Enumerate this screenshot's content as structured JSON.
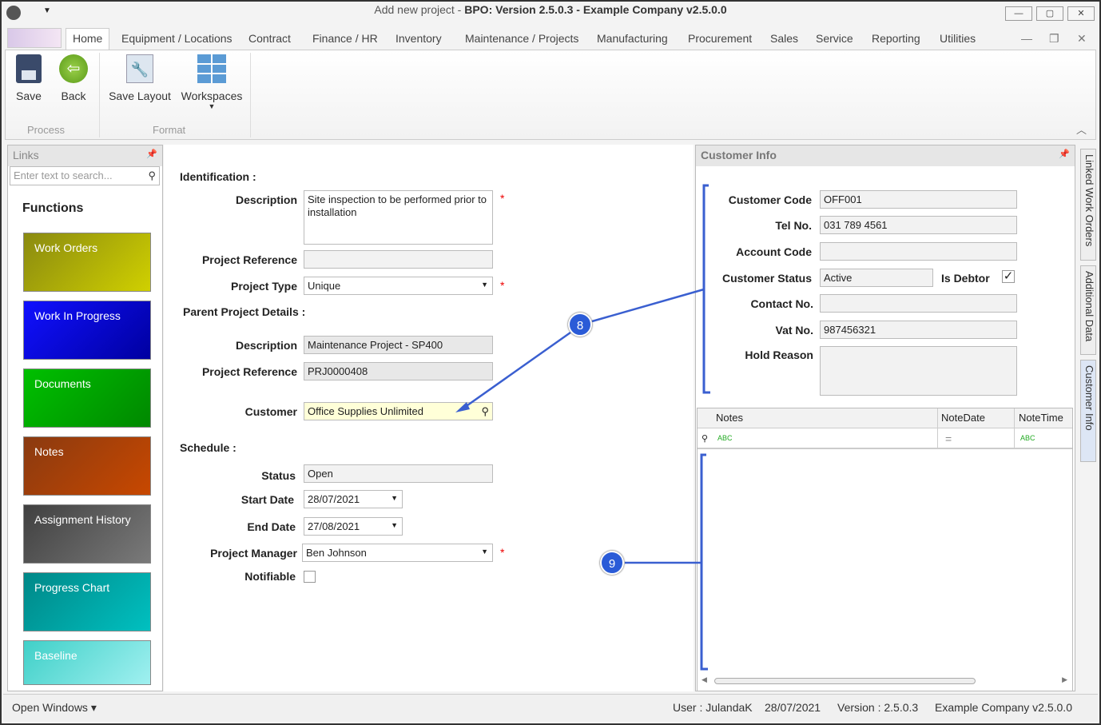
{
  "window": {
    "title_prefix": "Add new project",
    "title_sep": " - ",
    "title_main": "BPO: Version 2.5.0.3 - Example Company v2.5.0.0",
    "min": "—",
    "max": "▢",
    "close": "✕"
  },
  "tabs": [
    "Home",
    "Equipment / Locations",
    "Contract",
    "Finance / HR",
    "Inventory",
    "Maintenance / Projects",
    "Manufacturing",
    "Procurement",
    "Sales",
    "Service",
    "Reporting",
    "Utilities"
  ],
  "ribbon": {
    "save": "Save",
    "back": "Back",
    "save_layout": "Save Layout",
    "workspaces": "Workspaces",
    "group_process": "Process",
    "group_format": "Format"
  },
  "links": {
    "title": "Links",
    "search_placeholder": "Enter text to search...",
    "functions": "Functions",
    "tiles": [
      "Work Orders",
      "Work In Progress",
      "Documents",
      "Notes",
      "Assignment History",
      "Progress Chart",
      "Baseline"
    ]
  },
  "form": {
    "identification": "Identification :",
    "description_label": "Description",
    "description": "Site inspection to be performed prior to installation",
    "project_reference_label": "Project Reference",
    "project_reference": "",
    "project_type_label": "Project Type",
    "project_type": "Unique",
    "parent": "Parent Project Details :",
    "parent_description_label": "Description",
    "parent_description": "Maintenance Project - SP400",
    "parent_reference_label": "Project Reference",
    "parent_reference": "PRJ0000408",
    "customer_label": "Customer",
    "customer": "Office Supplies Unlimited",
    "schedule": "Schedule :",
    "status_label": "Status",
    "status": "Open",
    "start_label": "Start Date",
    "start": "28/07/2021",
    "end_label": "End Date",
    "end": "27/08/2021",
    "pm_label": "Project Manager",
    "pm": "Ben Johnson",
    "notifiable_label": "Notifiable",
    "required": "*"
  },
  "customer_info": {
    "title": "Customer Info",
    "code_label": "Customer Code",
    "code": "OFF001",
    "tel_label": "Tel No.",
    "tel": "031 789 4561",
    "account_label": "Account Code",
    "account": "",
    "status_label": "Customer Status",
    "status": "Active",
    "debtor_label": "Is Debtor",
    "contact_label": "Contact No.",
    "contact": "",
    "vat_label": "Vat No.",
    "vat": "987456321",
    "hold_label": "Hold Reason",
    "grid_columns": [
      "Notes",
      "NoteDate",
      "NoteTime"
    ]
  },
  "side_tabs": [
    "Linked Work Orders",
    "Additional Data",
    "Customer Info"
  ],
  "callouts": [
    "8",
    "9"
  ],
  "statusbar": {
    "open_windows": "Open Windows ▾",
    "user": "User : JulandaK",
    "date": "28/07/2021",
    "version": "Version : 2.5.0.3",
    "company": "Example Company v2.5.0.0"
  }
}
